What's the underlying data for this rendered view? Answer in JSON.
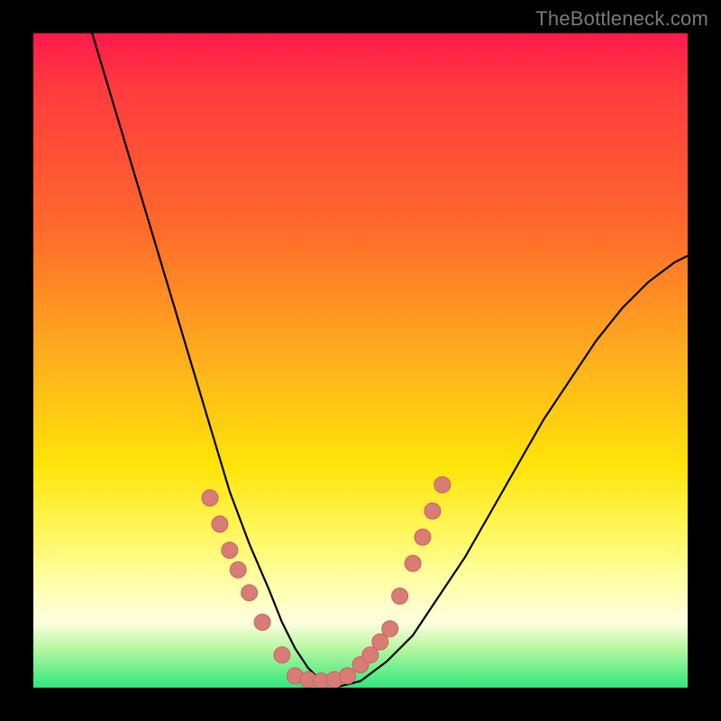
{
  "watermark": "TheBottleneck.com",
  "chart_data": {
    "type": "line",
    "title": "",
    "xlabel": "",
    "ylabel": "",
    "xlim": [
      0,
      100
    ],
    "ylim": [
      0,
      100
    ],
    "grid": false,
    "series": [
      {
        "name": "bottleneck-curve",
        "x": [
          9,
          12,
          15,
          18,
          21,
          24,
          27,
          30,
          33,
          36,
          38,
          40,
          42,
          44,
          46,
          50,
          54,
          58,
          62,
          66,
          70,
          74,
          78,
          82,
          86,
          90,
          94,
          98,
          100
        ],
        "y": [
          100,
          90,
          80,
          70,
          60,
          50,
          40,
          30,
          22,
          15,
          10,
          6,
          3,
          1,
          0,
          1,
          4,
          8,
          14,
          20,
          27,
          34,
          41,
          47,
          53,
          58,
          62,
          65,
          66
        ]
      }
    ],
    "markers": [
      {
        "name": "dots-left",
        "x": [
          27.0,
          28.5,
          30.0,
          31.3,
          33.0,
          35.0,
          38.0
        ],
        "y": [
          29.0,
          25.0,
          21.0,
          18.0,
          14.5,
          10.0,
          5.0
        ]
      },
      {
        "name": "dots-bottom",
        "x": [
          40.0,
          42.0,
          44.0,
          46.0,
          48.0
        ],
        "y": [
          1.8,
          1.2,
          1.0,
          1.2,
          1.8
        ]
      },
      {
        "name": "dots-right",
        "x": [
          50.0,
          51.5,
          53.0,
          54.5,
          56.0,
          58.0,
          59.5,
          61.0,
          62.5
        ],
        "y": [
          3.5,
          5.0,
          7.0,
          9.0,
          14.0,
          19.0,
          23.0,
          27.0,
          31.0
        ]
      }
    ],
    "colors": {
      "curve": "#000000",
      "marker_fill": "#d97b76",
      "marker_stroke": "#c76660"
    }
  }
}
